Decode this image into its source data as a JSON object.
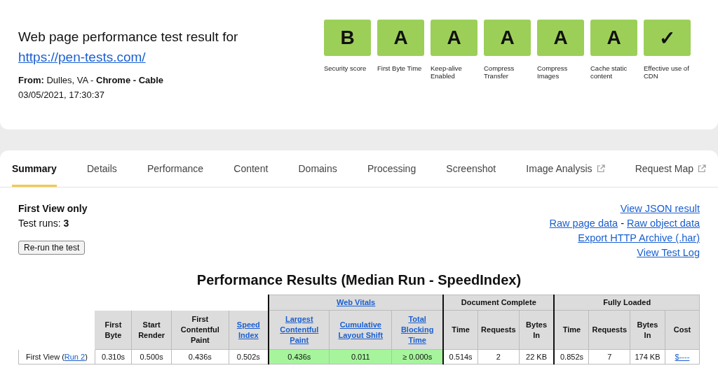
{
  "header": {
    "title": "Web page performance test result for",
    "url": "https://pen-tests.com/",
    "from_label": "From:",
    "location": " Dulles, VA - ",
    "browser": "Chrome - Cable",
    "date": "03/05/2021, 17:30:37"
  },
  "grades": [
    {
      "grade": "B",
      "label": "Security score"
    },
    {
      "grade": "A",
      "label": "First Byte Time"
    },
    {
      "grade": "A",
      "label": "Keep-alive Enabled"
    },
    {
      "grade": "A",
      "label": "Compress Transfer"
    },
    {
      "grade": "A",
      "label": "Compress Images"
    },
    {
      "grade": "A",
      "label": "Cache static content"
    },
    {
      "grade": "✓",
      "label": "Effective use of CDN"
    }
  ],
  "tabs": [
    {
      "label": "Summary",
      "selected": true,
      "external": false
    },
    {
      "label": "Details",
      "selected": false,
      "external": false
    },
    {
      "label": "Performance",
      "selected": false,
      "external": false
    },
    {
      "label": "Content",
      "selected": false,
      "external": false
    },
    {
      "label": "Domains",
      "selected": false,
      "external": false
    },
    {
      "label": "Processing",
      "selected": false,
      "external": false
    },
    {
      "label": "Screenshot",
      "selected": false,
      "external": false
    },
    {
      "label": "Image Analysis",
      "selected": false,
      "external": true
    },
    {
      "label": "Request Map",
      "selected": false,
      "external": true
    }
  ],
  "summary": {
    "view": "First View only",
    "runs_label": "Test runs: ",
    "runs": "3",
    "rerun_button": "Re-run the test"
  },
  "links": [
    [
      "View JSON result"
    ],
    [
      "Raw page data",
      "Raw object data"
    ],
    [
      "Export HTTP Archive (.har)"
    ],
    [
      "View Test Log"
    ]
  ],
  "link_separator": " - ",
  "results_title": "Performance Results (Median Run - SpeedIndex)",
  "table": {
    "groups": [
      {
        "columns": [
          {
            "label": "First Byte",
            "link": false
          },
          {
            "label": "Start Render",
            "link": false
          },
          {
            "label": "First Contentful Paint",
            "link": false
          },
          {
            "label": "Speed Index",
            "link": true
          }
        ]
      },
      {
        "title": "Web Vitals",
        "link": true,
        "columns": [
          {
            "label": "Largest Contentful Paint",
            "link": true
          },
          {
            "label": "Cumulative Layout Shift",
            "link": true
          },
          {
            "label": "Total Blocking Time",
            "link": true
          }
        ]
      },
      {
        "title": "Document Complete",
        "link": false,
        "columns": [
          {
            "label": "Time",
            "link": false
          },
          {
            "label": "Requests",
            "link": false
          },
          {
            "label": "Bytes In",
            "link": false
          }
        ]
      },
      {
        "title": "Fully Loaded",
        "link": false,
        "columns": [
          {
            "label": "Time",
            "link": false
          },
          {
            "label": "Requests",
            "link": false
          },
          {
            "label": "Bytes In",
            "link": false
          },
          {
            "label": "Cost",
            "link": false
          }
        ]
      }
    ],
    "rows": [
      {
        "label_prefix": "First View (",
        "label_link": "Run 2",
        "label_suffix": ")",
        "cells": [
          {
            "text": "0.310s",
            "kind": "plain"
          },
          {
            "text": "0.500s",
            "kind": "plain"
          },
          {
            "text": "0.436s",
            "kind": "plain"
          },
          {
            "text": "0.502s",
            "kind": "plain"
          },
          {
            "text": "0.436s",
            "kind": "good"
          },
          {
            "text": "0.011",
            "kind": "good"
          },
          {
            "text": "≥ 0.000s",
            "kind": "good"
          },
          {
            "text": "0.514s",
            "kind": "plain"
          },
          {
            "text": "2",
            "kind": "plain"
          },
          {
            "text": "22 KB",
            "kind": "plain"
          },
          {
            "text": "0.852s",
            "kind": "plain"
          },
          {
            "text": "7",
            "kind": "plain"
          },
          {
            "text": "174 KB",
            "kind": "plain"
          },
          {
            "text": "$----",
            "kind": "link"
          }
        ]
      }
    ]
  }
}
